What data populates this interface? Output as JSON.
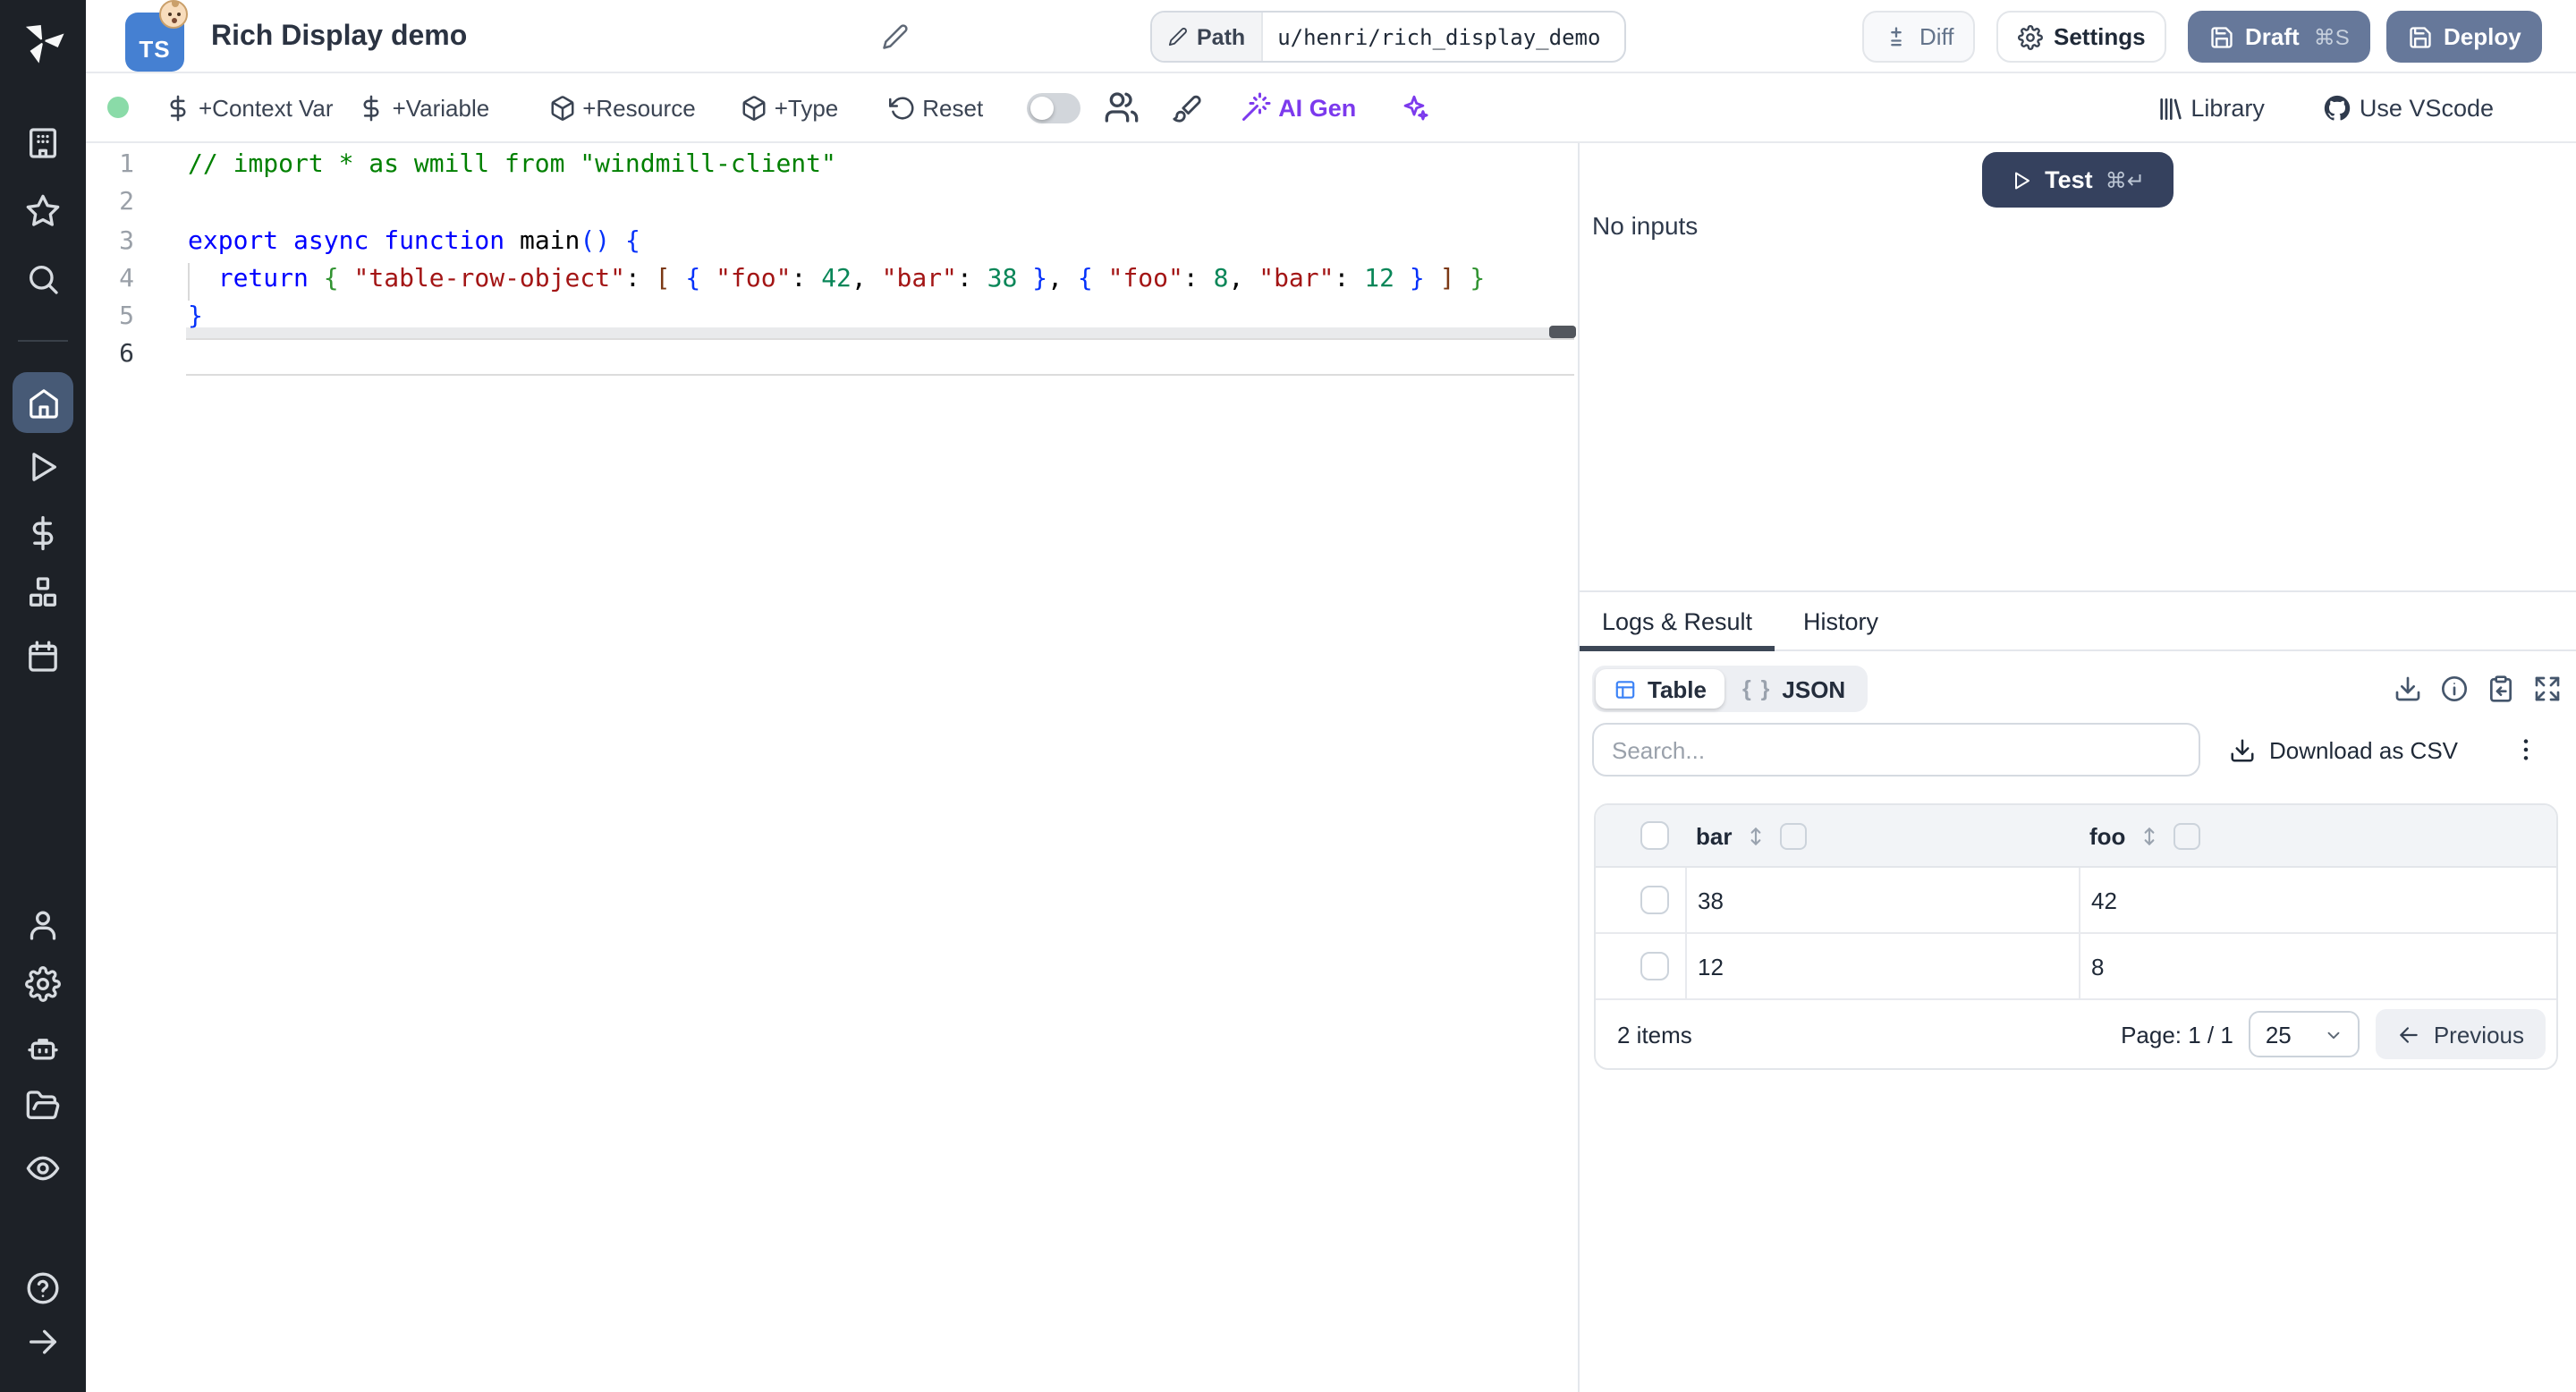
{
  "colors": {
    "sidebar_bg": "#1d2127",
    "sidebar_active_bg": "#475a76",
    "primary_button": "#66789a",
    "test_button": "#35415e",
    "ai_purple": "#7c3aed",
    "status_green": "#8adba8",
    "ts_badge_blue": "#4580d2",
    "table_icon_blue": "#3b82f6"
  },
  "sidebar": {
    "items": [
      {
        "icon": "building-icon"
      },
      {
        "icon": "star-icon"
      },
      {
        "icon": "search-icon"
      },
      {
        "icon": "home-icon",
        "active": true
      },
      {
        "icon": "play-icon"
      },
      {
        "icon": "dollar-icon"
      },
      {
        "icon": "cubes-icon"
      },
      {
        "icon": "calendar-icon"
      },
      {
        "icon": "user-icon"
      },
      {
        "icon": "gear-icon"
      },
      {
        "icon": "robot-icon"
      },
      {
        "icon": "folder-icon"
      },
      {
        "icon": "eye-icon"
      },
      {
        "icon": "help-icon"
      },
      {
        "icon": "arrow-right-icon"
      }
    ]
  },
  "topbar": {
    "language_badge": "TS",
    "title": "Rich Display demo",
    "path_label": "Path",
    "path_value": "u/henri/rich_display_demo",
    "diff_label": "Diff",
    "settings_label": "Settings",
    "draft_label": "Draft",
    "draft_shortcut": "⌘S",
    "deploy_label": "Deploy"
  },
  "toolbar": {
    "context_var": "+Context Var",
    "variable": "+Variable",
    "resource": "+Resource",
    "type": "+Type",
    "reset": "Reset",
    "ai_gen": "AI Gen",
    "library": "Library",
    "use_vscode": "Use VScode"
  },
  "editor": {
    "lines": [
      {
        "num": "1",
        "tokens": [
          {
            "t": "// import * as wmill from \"windmill-client\"",
            "c": "comment"
          }
        ]
      },
      {
        "num": "2",
        "tokens": []
      },
      {
        "num": "3",
        "tokens": [
          {
            "t": "export",
            "c": "keyword"
          },
          {
            "t": " ",
            "c": "plain"
          },
          {
            "t": "async",
            "c": "keyword"
          },
          {
            "t": " ",
            "c": "plain"
          },
          {
            "t": "function",
            "c": "keyword"
          },
          {
            "t": " ",
            "c": "plain"
          },
          {
            "t": "main",
            "c": "plain"
          },
          {
            "t": "()",
            "c": "b1"
          },
          {
            "t": " ",
            "c": "plain"
          },
          {
            "t": "{",
            "c": "b1"
          }
        ]
      },
      {
        "num": "4",
        "tokens": [
          {
            "t": "  ",
            "c": "plain"
          },
          {
            "t": "return",
            "c": "keyword"
          },
          {
            "t": " ",
            "c": "plain"
          },
          {
            "t": "{",
            "c": "b2"
          },
          {
            "t": " ",
            "c": "plain"
          },
          {
            "t": "\"table-row-object\"",
            "c": "string"
          },
          {
            "t": ": ",
            "c": "plain"
          },
          {
            "t": "[",
            "c": "b3"
          },
          {
            "t": " ",
            "c": "plain"
          },
          {
            "t": "{",
            "c": "b1"
          },
          {
            "t": " ",
            "c": "plain"
          },
          {
            "t": "\"foo\"",
            "c": "string"
          },
          {
            "t": ": ",
            "c": "plain"
          },
          {
            "t": "42",
            "c": "number"
          },
          {
            "t": ", ",
            "c": "plain"
          },
          {
            "t": "\"bar\"",
            "c": "string"
          },
          {
            "t": ": ",
            "c": "plain"
          },
          {
            "t": "38",
            "c": "number"
          },
          {
            "t": " ",
            "c": "plain"
          },
          {
            "t": "}",
            "c": "b1"
          },
          {
            "t": ", ",
            "c": "plain"
          },
          {
            "t": "{",
            "c": "b1"
          },
          {
            "t": " ",
            "c": "plain"
          },
          {
            "t": "\"foo\"",
            "c": "string"
          },
          {
            "t": ": ",
            "c": "plain"
          },
          {
            "t": "8",
            "c": "number"
          },
          {
            "t": ", ",
            "c": "plain"
          },
          {
            "t": "\"bar\"",
            "c": "string"
          },
          {
            "t": ": ",
            "c": "plain"
          },
          {
            "t": "12",
            "c": "number"
          },
          {
            "t": " ",
            "c": "plain"
          },
          {
            "t": "}",
            "c": "b1"
          },
          {
            "t": " ",
            "c": "plain"
          },
          {
            "t": "]",
            "c": "b3"
          },
          {
            "t": " ",
            "c": "plain"
          },
          {
            "t": "}",
            "c": "b2"
          }
        ]
      },
      {
        "num": "5",
        "tokens": [
          {
            "t": "}",
            "c": "b1"
          }
        ]
      },
      {
        "num": "6",
        "tokens": [],
        "current": true
      }
    ]
  },
  "run_panel": {
    "test_label": "Test",
    "test_shortcut": "⌘↵",
    "no_inputs": "No inputs"
  },
  "result_panel": {
    "tabs": [
      {
        "label": "Logs & Result",
        "active": true
      },
      {
        "label": "History"
      }
    ],
    "view_table_label": "Table",
    "view_json_label": "JSON",
    "json_braces": "{ }",
    "search_placeholder": "Search...",
    "download_csv": "Download as CSV"
  },
  "result_table": {
    "columns": [
      "bar",
      "foo"
    ],
    "rows": [
      [
        "38",
        "42"
      ],
      [
        "12",
        "8"
      ]
    ],
    "items_count": "2 items",
    "page_label": "Page: 1 / 1",
    "page_size": "25",
    "prev_label": "Previous"
  }
}
